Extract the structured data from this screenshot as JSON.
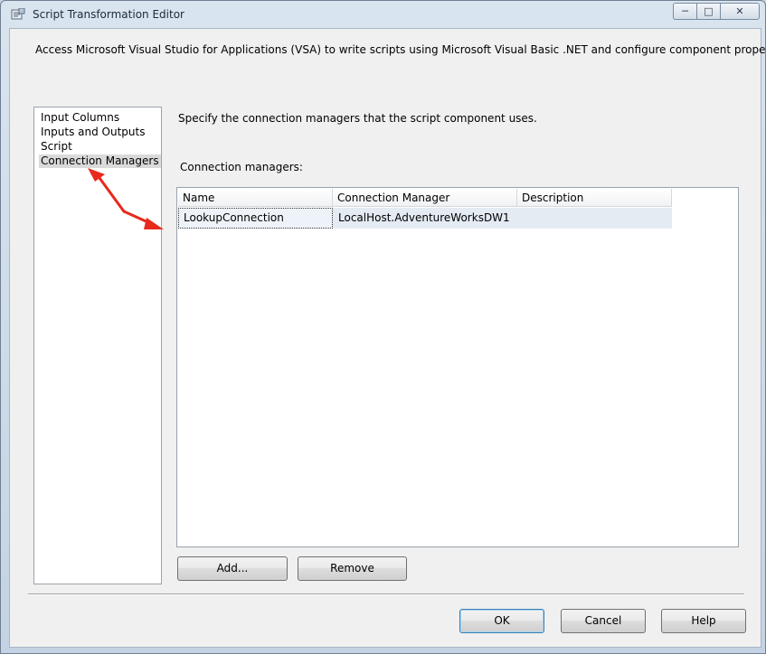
{
  "window": {
    "title": "Script Transformation Editor",
    "icon": "script-editor-icon",
    "controls": [
      "minimize",
      "maximize",
      "close"
    ]
  },
  "description": "Access Microsoft Visual Studio for Applications (VSA) to write scripts using Microsoft Visual Basic .NET and configure component properties.",
  "nav": {
    "items": [
      {
        "label": "Input Columns",
        "selected": false
      },
      {
        "label": "Inputs and Outputs",
        "selected": false
      },
      {
        "label": "Script",
        "selected": false
      },
      {
        "label": "Connection Managers",
        "selected": true
      }
    ]
  },
  "main": {
    "instruction": "Specify the connection managers that the script component uses.",
    "connection_managers_label": "Connection managers:",
    "grid": {
      "columns": [
        "Name",
        "Connection Manager",
        "Description"
      ],
      "rows": [
        [
          "LookupConnection",
          "LocalHost.AdventureWorksDW1",
          ""
        ]
      ]
    },
    "add_label": "Add...",
    "remove_label": "Remove"
  },
  "footer": {
    "ok_label": "OK",
    "cancel_label": "Cancel",
    "help_label": "Help"
  },
  "colors": {
    "annotation_arrow": "#e8291c",
    "selection": "#dadada",
    "row_highlight": "#e4ebf3"
  }
}
